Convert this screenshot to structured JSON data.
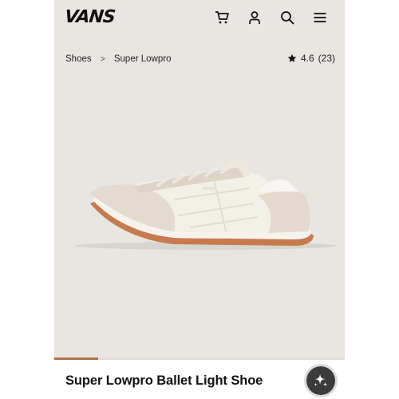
{
  "header": {
    "logo_text": "VANS",
    "icons": [
      "cart-icon",
      "account-icon",
      "search-icon",
      "menu-icon"
    ]
  },
  "breadcrumb": {
    "items": [
      "Shoes",
      "Super Lowpro"
    ]
  },
  "rating": {
    "value": "4.6",
    "count": "(23)"
  },
  "product": {
    "title": "Super Lowpro Ballet Light Shoe",
    "image_carousel_progress": 0.15
  },
  "colors": {
    "background": "#e9e6e1",
    "progress_accent": "#b0734a",
    "ai_button": "#3b3b3b"
  }
}
